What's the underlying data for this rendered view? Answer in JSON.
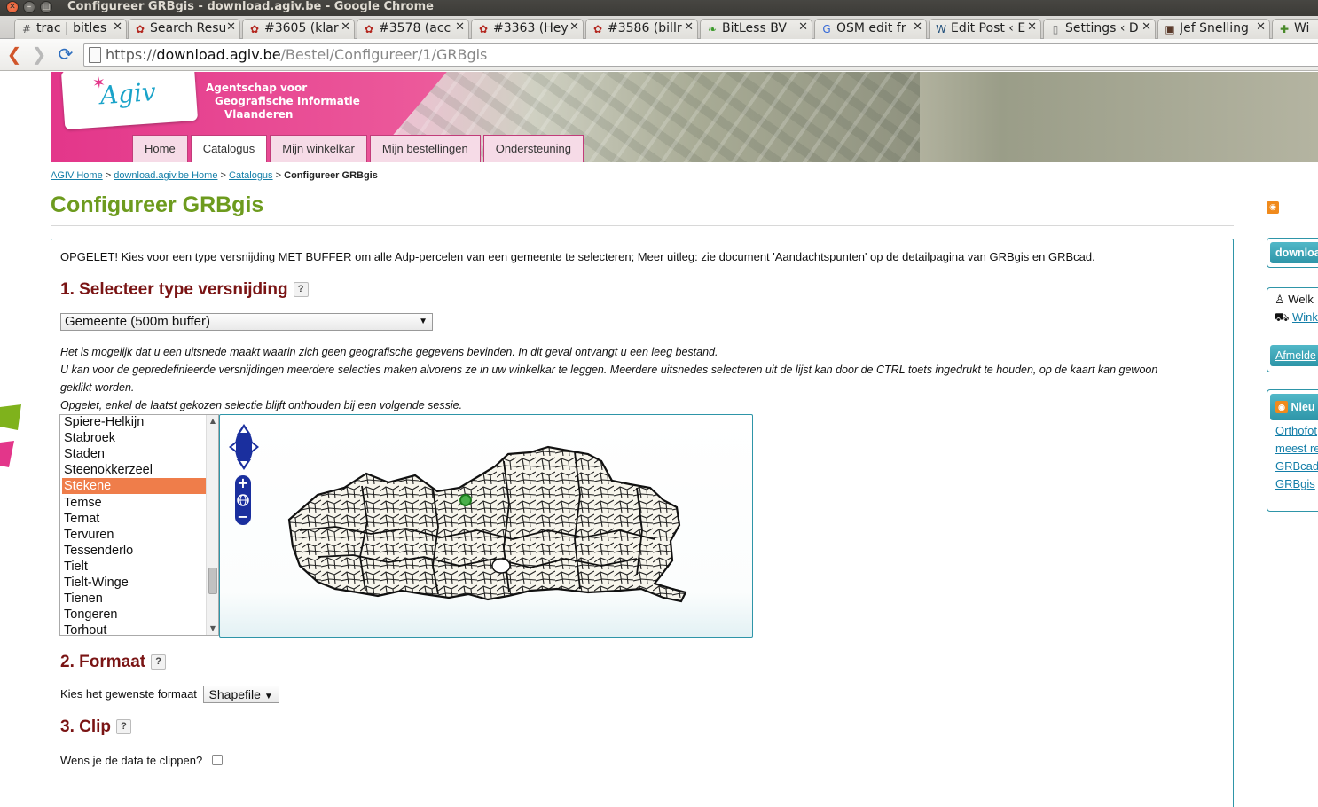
{
  "window": {
    "title": "Configureer GRBgis - download.agiv.be - Google Chrome"
  },
  "tabs": [
    {
      "label": "trac | bitles",
      "icon": "trac-icon"
    },
    {
      "label": "Search Resu",
      "icon": "paw-icon"
    },
    {
      "label": "#3605 (klar",
      "icon": "paw-icon"
    },
    {
      "label": "#3578 (acc",
      "icon": "paw-icon"
    },
    {
      "label": "#3363 (Hey",
      "icon": "paw-icon"
    },
    {
      "label": "#3586 (billr",
      "icon": "paw-icon"
    },
    {
      "label": "BitLess BV",
      "icon": "leaf-icon"
    },
    {
      "label": "OSM edit fr",
      "icon": "google-icon"
    },
    {
      "label": "Edit Post ‹ E",
      "icon": "wordpress-icon"
    },
    {
      "label": "Settings ‹ D",
      "icon": "page-icon"
    },
    {
      "label": "Jef Snelling",
      "icon": "photo-icon"
    },
    {
      "label": "Wik",
      "icon": "puzzle-icon"
    }
  ],
  "omnibox": {
    "scheme": "https://",
    "host": "download.agiv.be",
    "path": "/Bestel/Configureer/1/GRBgis"
  },
  "header": {
    "logo": "Agiv",
    "agency_line1": "Agentschap voor",
    "agency_line2": "Geografische Informatie",
    "agency_line3": "Vlaanderen",
    "nav": [
      {
        "label": "Home"
      },
      {
        "label": "Catalogus",
        "active": true
      },
      {
        "label": "Mijn winkelkar"
      },
      {
        "label": "Mijn bestellingen"
      },
      {
        "label": "Ondersteuning"
      }
    ]
  },
  "breadcrumb": {
    "home": "AGIV Home",
    "download_home": "download.agiv.be Home",
    "catalogus": "Catalogus",
    "current": "Configureer GRBgis",
    "sep": ">"
  },
  "page_title": "Configureer GRBgis",
  "notice": "OPGELET! Kies voor een type versnijding MET BUFFER om alle Adp-percelen van een gemeente te selecteren; Meer uitleg: zie document 'Aandachtspunten' op de detailpagina van GRBgis en GRBcad.",
  "section1": {
    "heading": "1. Selecteer type versnijding",
    "help": "?",
    "selected_type": "Gemeente (500m buffer)",
    "info_line1": "Het is mogelijk dat u een uitsnede maakt waarin zich geen geografische gegevens bevinden. In dit geval ontvangt u een leeg bestand.",
    "info_line2": "U kan voor de gepredefinieerde versnijdingen meerdere selecties maken alvorens ze in uw winkelkar te leggen. Meerdere uitsnedes selecteren uit de lijst kan door de CTRL toets ingedrukt te houden, op de kaart kan gewoon",
    "info_line3": "geklikt worden.",
    "info_line4": "Opgelet, enkel de laatst gekozen selectie blijft onthouden bij een volgende sessie.",
    "municipalities": [
      "Spiere-Helkijn",
      "Stabroek",
      "Staden",
      "Steenokkerzeel",
      "Stekene",
      "Temse",
      "Ternat",
      "Tervuren",
      "Tessenderlo",
      "Tielt",
      "Tielt-Winge",
      "Tienen",
      "Tongeren",
      "Torhout"
    ],
    "selected_municipality": "Stekene"
  },
  "section2": {
    "heading": "2. Formaat",
    "help": "?",
    "label": "Kies het gewenste formaat",
    "selected_format": "Shapefile"
  },
  "section3": {
    "heading": "3. Clip",
    "help": "?",
    "label": "Wens je de data te clippen?",
    "checked": false
  },
  "sidebar": {
    "download_button": "downloa",
    "welcome": "Welk",
    "cart_link": "Winke",
    "logout_button": "Afmelde",
    "news_title": "Nieu",
    "news_links": [
      "Orthofot",
      "meest re",
      "GRBcad",
      "GRBgis"
    ]
  },
  "colors": {
    "brand_pink": "#e3368a",
    "accent_teal": "#2e95a8",
    "title_green": "#6d9b1e",
    "heading_maroon": "#7a1414",
    "selection_orange": "#ef7d4a"
  }
}
